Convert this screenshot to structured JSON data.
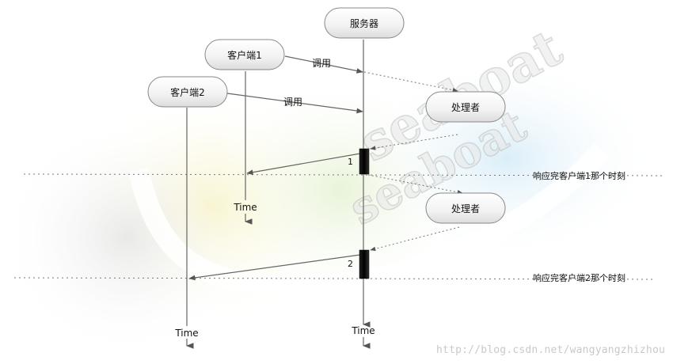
{
  "participants": {
    "server": "服务器",
    "client1": "客户端1",
    "client2": "客户端2",
    "handler_a": "处理者",
    "handler_b": "处理者"
  },
  "messages": {
    "call_client1": "调用",
    "call_client2": "调用",
    "response_1": "1",
    "response_2": "2"
  },
  "time_labels": {
    "client1": "Time",
    "client2": "Time",
    "server": "Time"
  },
  "moments": {
    "moment_1": "响应完客户端1那个时刻",
    "moment_2": "响应完客户端2那个时刻"
  },
  "watermark": {
    "logo_text": "seaboat",
    "url": "http://blog.csdn.net/wangyangzhizhou"
  },
  "colors": {
    "line": "#666666",
    "dotted": "#777777",
    "activation": "#111111",
    "node_border": "#888888"
  }
}
